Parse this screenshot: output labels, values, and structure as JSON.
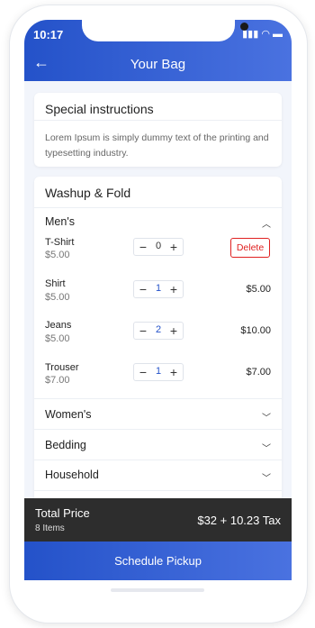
{
  "status": {
    "time": "10:17"
  },
  "header": {
    "title": "Your Bag"
  },
  "instructions": {
    "title": "Special instructions",
    "text": "Lorem Ipsum is simply dummy text of the printing and typesetting industry."
  },
  "service": {
    "title": "Washup & Fold",
    "mens": {
      "label": "Men's",
      "items": [
        {
          "name": "T-Shirt",
          "price": "$5.00",
          "qty": "0",
          "action": "Delete"
        },
        {
          "name": "Shirt",
          "price": "$5.00",
          "qty": "1",
          "total": "$5.00"
        },
        {
          "name": "Jeans",
          "price": "$5.00",
          "qty": "2",
          "total": "$10.00"
        },
        {
          "name": "Trouser",
          "price": "$7.00",
          "qty": "1",
          "total": "$7.00"
        }
      ]
    },
    "categories": [
      "Women's",
      "Bedding",
      "Household"
    ]
  },
  "footer": {
    "total_label": "Total Price",
    "items_count": "8 Items",
    "total_value": "$32 + 10.23 Tax",
    "cta": "Schedule Pickup"
  }
}
